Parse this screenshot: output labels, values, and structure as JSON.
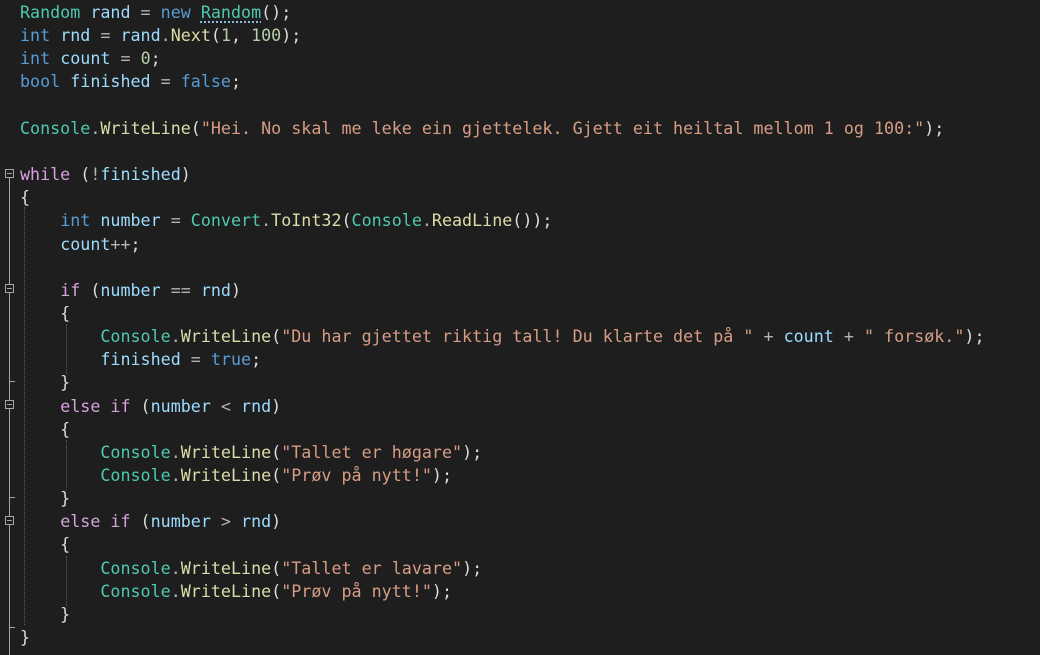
{
  "code_lines": [
    [
      {
        "t": "Random",
        "c": "type"
      },
      {
        "t": " ",
        "c": "p"
      },
      {
        "t": "rand",
        "c": "var"
      },
      {
        "t": " = ",
        "c": "op"
      },
      {
        "t": "new",
        "c": "kw"
      },
      {
        "t": " ",
        "c": "p"
      },
      {
        "t": "Random",
        "c": "type",
        "squig": true
      },
      {
        "t": "();",
        "c": "p"
      }
    ],
    [
      {
        "t": "int",
        "c": "kw"
      },
      {
        "t": " ",
        "c": "p"
      },
      {
        "t": "rnd",
        "c": "var"
      },
      {
        "t": " = ",
        "c": "op"
      },
      {
        "t": "rand",
        "c": "var"
      },
      {
        "t": ".",
        "c": "op"
      },
      {
        "t": "Next",
        "c": "fn"
      },
      {
        "t": "(",
        "c": "p"
      },
      {
        "t": "1",
        "c": "num"
      },
      {
        "t": ", ",
        "c": "p"
      },
      {
        "t": "100",
        "c": "num"
      },
      {
        "t": ");",
        "c": "p"
      }
    ],
    [
      {
        "t": "int",
        "c": "kw"
      },
      {
        "t": " ",
        "c": "p"
      },
      {
        "t": "count",
        "c": "var"
      },
      {
        "t": " = ",
        "c": "op"
      },
      {
        "t": "0",
        "c": "num"
      },
      {
        "t": ";",
        "c": "p"
      }
    ],
    [
      {
        "t": "bool",
        "c": "kw"
      },
      {
        "t": " ",
        "c": "p"
      },
      {
        "t": "finished",
        "c": "var"
      },
      {
        "t": " = ",
        "c": "op"
      },
      {
        "t": "false",
        "c": "kw"
      },
      {
        "t": ";",
        "c": "p"
      }
    ],
    [],
    [
      {
        "t": "Console",
        "c": "type"
      },
      {
        "t": ".",
        "c": "op"
      },
      {
        "t": "WriteLine",
        "c": "fn"
      },
      {
        "t": "(",
        "c": "p"
      },
      {
        "t": "\"Hei. No skal me leke ein gjettelek. Gjett eit heiltal mellom 1 og 100:\"",
        "c": "str"
      },
      {
        "t": ");",
        "c": "p"
      }
    ],
    [],
    [
      {
        "t": "while",
        "c": "ctl"
      },
      {
        "t": " (",
        "c": "p"
      },
      {
        "t": "!",
        "c": "op"
      },
      {
        "t": "finished",
        "c": "var"
      },
      {
        "t": ")",
        "c": "p"
      }
    ],
    [
      {
        "t": "{",
        "c": "p"
      }
    ],
    [
      {
        "t": "    ",
        "c": "p"
      },
      {
        "t": "int",
        "c": "kw"
      },
      {
        "t": " ",
        "c": "p"
      },
      {
        "t": "number",
        "c": "var"
      },
      {
        "t": " = ",
        "c": "op"
      },
      {
        "t": "Convert",
        "c": "type"
      },
      {
        "t": ".",
        "c": "op"
      },
      {
        "t": "ToInt32",
        "c": "fn"
      },
      {
        "t": "(",
        "c": "p"
      },
      {
        "t": "Console",
        "c": "type"
      },
      {
        "t": ".",
        "c": "op"
      },
      {
        "t": "ReadLine",
        "c": "fn"
      },
      {
        "t": "());",
        "c": "p"
      }
    ],
    [
      {
        "t": "    ",
        "c": "p"
      },
      {
        "t": "count",
        "c": "var"
      },
      {
        "t": "++",
        "c": "op"
      },
      {
        "t": ";",
        "c": "p"
      }
    ],
    [],
    [
      {
        "t": "    ",
        "c": "p"
      },
      {
        "t": "if",
        "c": "ctl"
      },
      {
        "t": " (",
        "c": "p"
      },
      {
        "t": "number",
        "c": "var"
      },
      {
        "t": " == ",
        "c": "op"
      },
      {
        "t": "rnd",
        "c": "var"
      },
      {
        "t": ")",
        "c": "p"
      }
    ],
    [
      {
        "t": "    {",
        "c": "p"
      }
    ],
    [
      {
        "t": "        ",
        "c": "p"
      },
      {
        "t": "Console",
        "c": "type"
      },
      {
        "t": ".",
        "c": "op"
      },
      {
        "t": "WriteLine",
        "c": "fn"
      },
      {
        "t": "(",
        "c": "p"
      },
      {
        "t": "\"Du har gjettet riktig tall! Du klarte det på \"",
        "c": "str"
      },
      {
        "t": " + ",
        "c": "op"
      },
      {
        "t": "count",
        "c": "var"
      },
      {
        "t": " + ",
        "c": "op"
      },
      {
        "t": "\" forsøk.\"",
        "c": "str"
      },
      {
        "t": ");",
        "c": "p"
      }
    ],
    [
      {
        "t": "        ",
        "c": "p"
      },
      {
        "t": "finished",
        "c": "var"
      },
      {
        "t": " = ",
        "c": "op"
      },
      {
        "t": "true",
        "c": "kw"
      },
      {
        "t": ";",
        "c": "p"
      }
    ],
    [
      {
        "t": "    }",
        "c": "p"
      }
    ],
    [
      {
        "t": "    ",
        "c": "p"
      },
      {
        "t": "else",
        "c": "ctl"
      },
      {
        "t": " ",
        "c": "p"
      },
      {
        "t": "if",
        "c": "ctl"
      },
      {
        "t": " (",
        "c": "p"
      },
      {
        "t": "number",
        "c": "var"
      },
      {
        "t": " < ",
        "c": "op"
      },
      {
        "t": "rnd",
        "c": "var"
      },
      {
        "t": ")",
        "c": "p"
      }
    ],
    [
      {
        "t": "    {",
        "c": "p"
      }
    ],
    [
      {
        "t": "        ",
        "c": "p"
      },
      {
        "t": "Console",
        "c": "type"
      },
      {
        "t": ".",
        "c": "op"
      },
      {
        "t": "WriteLine",
        "c": "fn"
      },
      {
        "t": "(",
        "c": "p"
      },
      {
        "t": "\"Tallet er høgare\"",
        "c": "str"
      },
      {
        "t": ");",
        "c": "p"
      }
    ],
    [
      {
        "t": "        ",
        "c": "p"
      },
      {
        "t": "Console",
        "c": "type"
      },
      {
        "t": ".",
        "c": "op"
      },
      {
        "t": "WriteLine",
        "c": "fn"
      },
      {
        "t": "(",
        "c": "p"
      },
      {
        "t": "\"Prøv på nytt!\"",
        "c": "str"
      },
      {
        "t": ");",
        "c": "p"
      }
    ],
    [
      {
        "t": "    }",
        "c": "p"
      }
    ],
    [
      {
        "t": "    ",
        "c": "p"
      },
      {
        "t": "else",
        "c": "ctl"
      },
      {
        "t": " ",
        "c": "p"
      },
      {
        "t": "if",
        "c": "ctl"
      },
      {
        "t": " (",
        "c": "p"
      },
      {
        "t": "number",
        "c": "var"
      },
      {
        "t": " > ",
        "c": "op"
      },
      {
        "t": "rnd",
        "c": "var"
      },
      {
        "t": ")",
        "c": "p"
      }
    ],
    [
      {
        "t": "    {",
        "c": "p"
      }
    ],
    [
      {
        "t": "        ",
        "c": "p"
      },
      {
        "t": "Console",
        "c": "type"
      },
      {
        "t": ".",
        "c": "op"
      },
      {
        "t": "WriteLine",
        "c": "fn"
      },
      {
        "t": "(",
        "c": "p"
      },
      {
        "t": "\"Tallet er lavare\"",
        "c": "str"
      },
      {
        "t": ");",
        "c": "p"
      }
    ],
    [
      {
        "t": "        ",
        "c": "p"
      },
      {
        "t": "Console",
        "c": "type"
      },
      {
        "t": ".",
        "c": "op"
      },
      {
        "t": "WriteLine",
        "c": "fn"
      },
      {
        "t": "(",
        "c": "p"
      },
      {
        "t": "\"Prøv på nytt!\"",
        "c": "str"
      },
      {
        "t": ");",
        "c": "p"
      }
    ],
    [
      {
        "t": "    }",
        "c": "p"
      }
    ],
    [
      {
        "t": "}",
        "c": "p"
      }
    ]
  ]
}
